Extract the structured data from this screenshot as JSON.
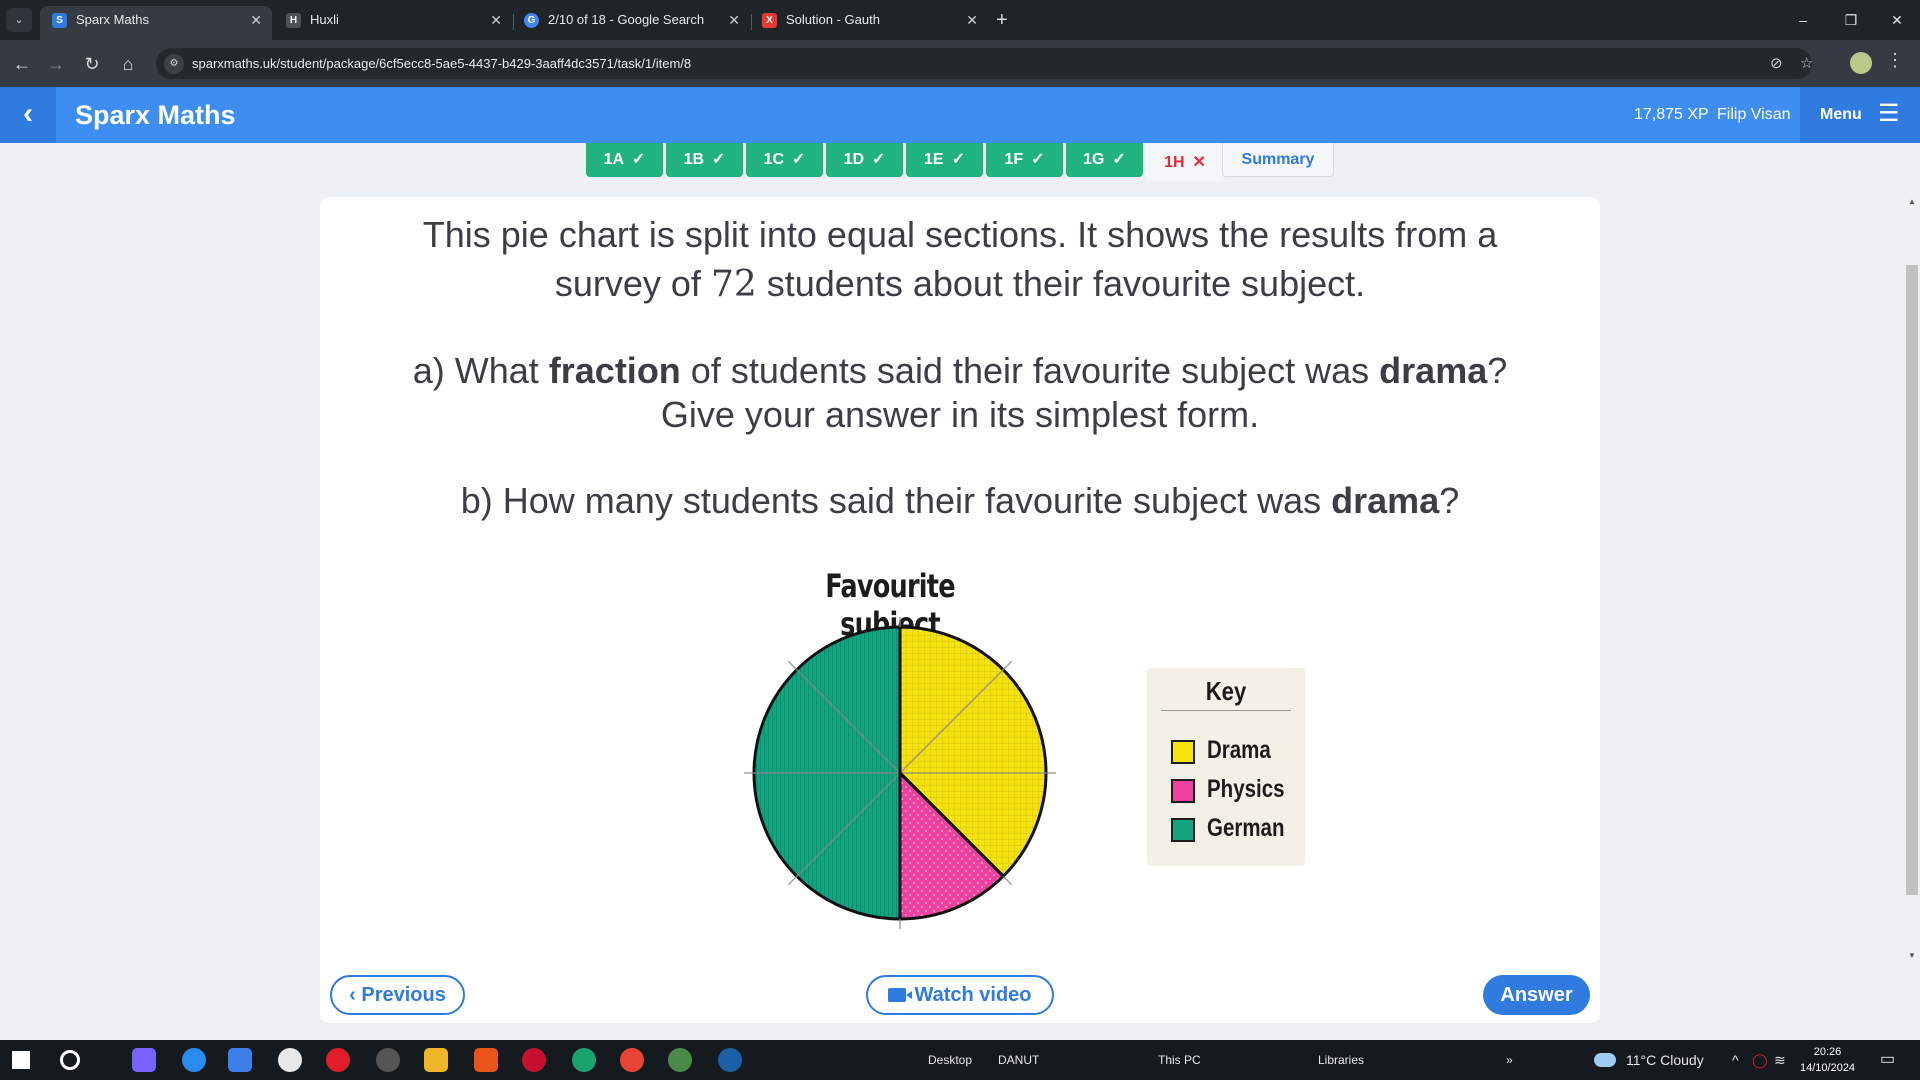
{
  "browser": {
    "tabs": [
      {
        "title": "Sparx Maths",
        "icon": "S",
        "color": "#2f7be0",
        "active": true
      },
      {
        "title": "Huxli",
        "icon": "H",
        "color": "#6c757d",
        "active": false
      },
      {
        "title": "2/10 of 18 - Google Search",
        "icon": "G",
        "color": "#4285f4",
        "active": false
      },
      {
        "title": "Solution - Gauth",
        "icon": "X",
        "color": "#e53935",
        "active": false
      }
    ],
    "url": "sparxmaths.uk/student/package/6cf5ecc8-5ae5-4437-b429-3aaff4dc3571/task/1/item/8"
  },
  "header": {
    "brand": "Sparx Maths",
    "xp": "17,875 XP",
    "user": "Filip Visan",
    "menu_label": "Menu"
  },
  "task_tabs": [
    {
      "label": "1A",
      "status": "done"
    },
    {
      "label": "1B",
      "status": "done"
    },
    {
      "label": "1C",
      "status": "done"
    },
    {
      "label": "1D",
      "status": "done"
    },
    {
      "label": "1E",
      "status": "done"
    },
    {
      "label": "1F",
      "status": "done"
    },
    {
      "label": "1G",
      "status": "done"
    },
    {
      "label": "1H",
      "status": "current"
    }
  ],
  "summary_label": "Summary",
  "question": {
    "intro_1": "This pie chart is split into equal sections. It shows the results from a",
    "intro_2_pre": "survey of ",
    "intro_2_num": "72",
    "intro_2_post": " students about their favourite subject.",
    "a_pre": "a) What ",
    "a_bold1": "fraction",
    "a_mid": " of students said their favourite subject was ",
    "a_bold2": "drama",
    "a_post": "?",
    "a_line2": "Give your answer in its simplest form.",
    "b_pre": "b) How many students said their favourite subject was ",
    "b_bold": "drama",
    "b_post": "?"
  },
  "chart_data": {
    "type": "pie",
    "title": "Favourite subject",
    "sections_total": 8,
    "slices": [
      {
        "label": "Drama",
        "sections": 3,
        "color": "#f5e20f"
      },
      {
        "label": "Physics",
        "sections": 1,
        "color": "#ef3fa0"
      },
      {
        "label": "German",
        "sections": 4,
        "color": "#12a37f"
      }
    ],
    "key_title": "Key"
  },
  "buttons": {
    "previous": "Previous",
    "watch_video": "Watch video",
    "answer": "Answer"
  },
  "taskbar": {
    "desktop": "Desktop",
    "user": "DANUT",
    "this_pc": "This PC",
    "libraries": "Libraries",
    "weather": "11°C  Cloudy",
    "time": "20:26",
    "date": "14/10/2024"
  }
}
